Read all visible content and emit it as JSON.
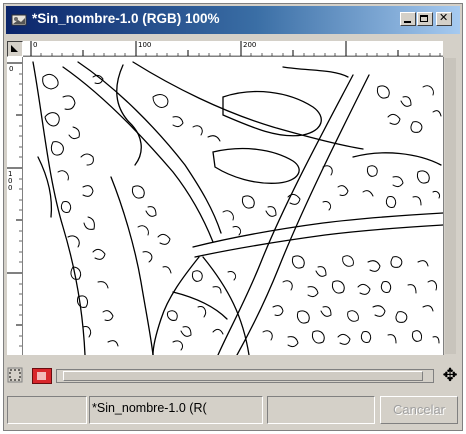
{
  "window": {
    "title": "*Sin_nombre-1.0 (RGB) 100%"
  },
  "rulers": {
    "horizontal_labels": [
      "0",
      "100",
      "200"
    ],
    "vertical_labels": [
      "0",
      "100"
    ]
  },
  "statusbar": {
    "image_name": "*Sin_nombre-1.0 (R(",
    "cancel_label": "Cancelar"
  },
  "icons": {
    "app": "gimp-image-icon",
    "quick_mask": "quick-mask-icon",
    "navigate": "navigate-icon",
    "move": "move-arrows-icon"
  },
  "colors": {
    "title_start": "#0a246a",
    "title_end": "#a6caf0",
    "chrome": "#d4d0c8",
    "canvas": "#ffffff",
    "edges": "#000000"
  }
}
